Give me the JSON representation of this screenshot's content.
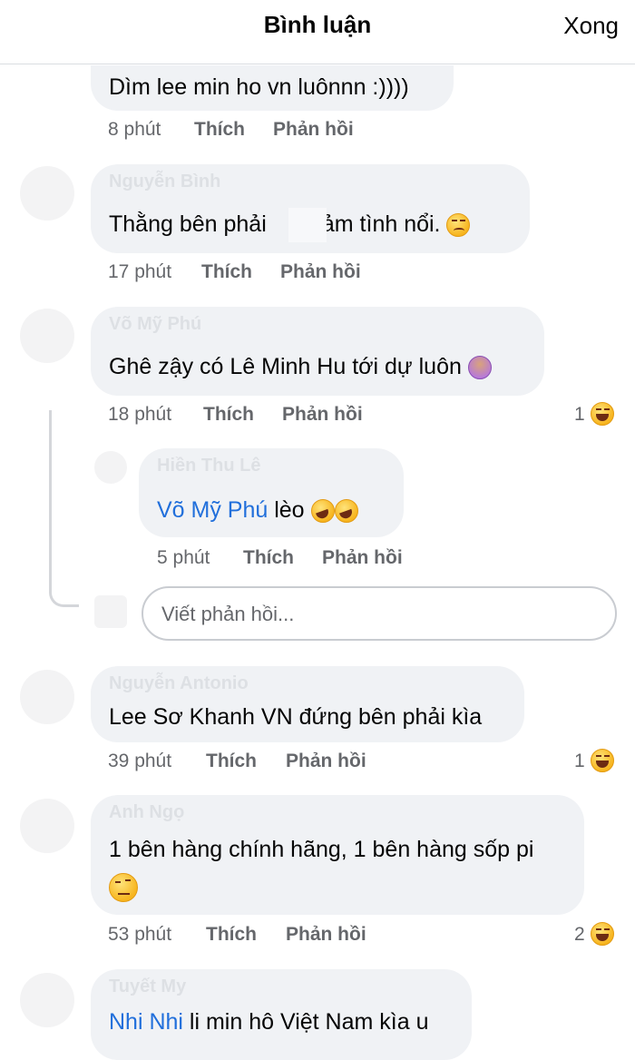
{
  "header": {
    "title": "Bình luận",
    "done_label": "Xong"
  },
  "comments": [
    {
      "text": "Dìm lee min ho vn luônnn :))))",
      "time": "8 phút",
      "like": "Thích",
      "reply": "Phản hồi"
    },
    {
      "author": "Nguyễn Bình",
      "text": "Thằng bên phải       cảm tình nổi.",
      "time": "17 phút",
      "like": "Thích",
      "reply": "Phản hồi"
    },
    {
      "author": "Võ Mỹ Phú",
      "text": "Ghê zậy có Lê Minh Hu tới dự luôn",
      "time": "18 phút",
      "like": "Thích",
      "reply": "Phản hồi",
      "reactions": "1"
    },
    {
      "author": "Nguyễn Antonio",
      "text": "Lee Sơ Khanh VN đứng bên phải kìa",
      "time": "39 phút",
      "like": "Thích",
      "reply": "Phản hồi",
      "reactions": "1"
    },
    {
      "author": "Anh Ngọ",
      "text_line1": "1 bên hàng chính hãng, 1 bên hàng sốp pi",
      "time": "53 phút",
      "like": "Thích",
      "reply": "Phản hồi",
      "reactions": "2"
    },
    {
      "author": "Tuyết My",
      "mention": "Nhi Nhi",
      "text": " li min hô Việt Nam kìa u"
    }
  ],
  "reply_comment": {
    "author": "Hiền Thu Lê",
    "mention": "Võ Mỹ Phú",
    "text": " lèo",
    "time": "5 phút",
    "like": "Thích",
    "reply": "Phản hồi"
  },
  "reply_input": {
    "placeholder": "Viết phản hồi..."
  },
  "icons": [
    "woozy-face-emoji",
    "shrugging-woman-emoji",
    "rofl-emoji",
    "laughing-reaction-icon",
    "face-with-raised-eyebrow-emoji"
  ]
}
